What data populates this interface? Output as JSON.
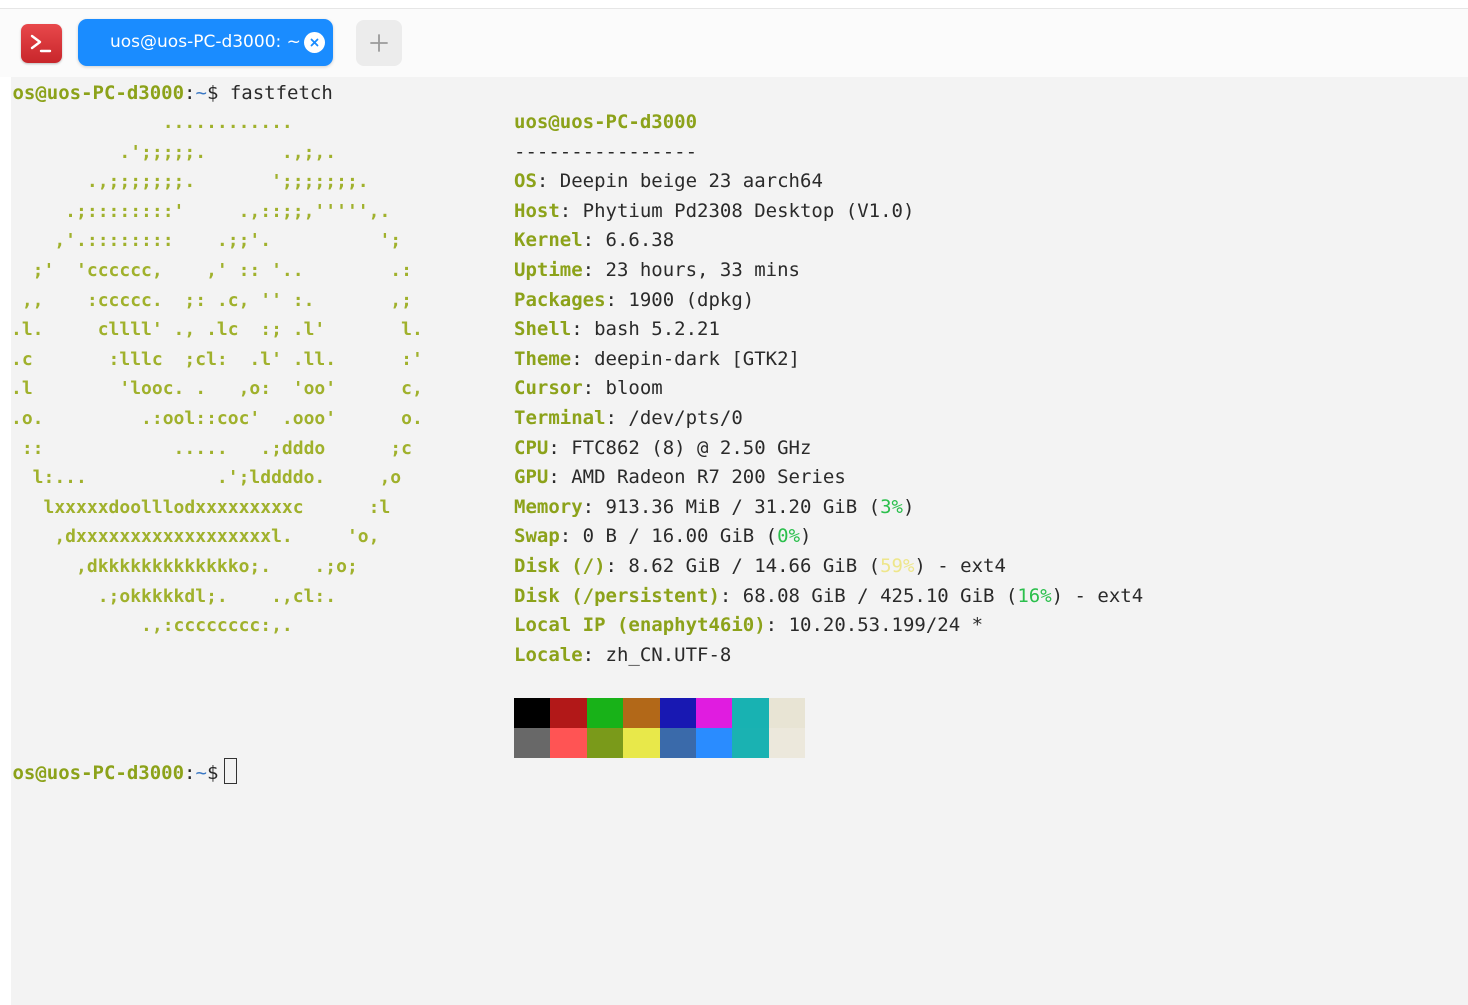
{
  "window": {
    "tab_title": "uos@uos-PC-d3000: ~",
    "icon_names": [
      "terminal-app-icon",
      "close-icon",
      "plus-icon"
    ]
  },
  "terminal": {
    "prompt1": {
      "user_host": "uos@uos-PC-d3000",
      "sep": ":",
      "path": "~",
      "dollar": "$",
      "command": " fastfetch"
    },
    "prompt2": {
      "user_host": "uos@uos-PC-d3000",
      "sep": ":",
      "path": "~",
      "dollar": "$"
    },
    "logo_color": "#a0b12c",
    "logo_lines": [
      "              ............",
      "          .';;;;;.       .,;,.",
      "       .,;;;;;;;.       ';;;;;;;.",
      "     .;::::::::'     .,::;;,''''',.",
      "    ,'.::::::::    .;;'.          ';",
      "  ;'  'cccccc,    ,' :: '..        .:",
      " ,,    :ccccc.  ;: .c, '' :.       ,;",
      ".l.     cllll' ., .lc  :; .l'       l.",
      ".c       :lllc  ;cl:  .l' .ll.      :'",
      ".l        'looc. .   ,o:  'oo'      c,",
      ".o.         .:ool::coc'  .ooo'      o.",
      " ::            .....   .;dddo      ;c",
      "  l:...            .';lddddo.     ,o",
      "   lxxxxxdoolllodxxxxxxxxxc      :l",
      "    ,dxxxxxxxxxxxxxxxxxxl.     'o,",
      "      ,dkkkkkkkkkkkkko;.    .;o;",
      "        .;okkkkkdl;.    .,cl:.",
      "            .,:cccccccc:,."
    ],
    "info": {
      "title": "uos@uos-PC-d3000",
      "separator": "----------------",
      "entries": [
        {
          "key": "OS",
          "value": "Deepin beige 23 aarch64"
        },
        {
          "key": "Host",
          "value": "Phytium Pd2308 Desktop (V1.0)"
        },
        {
          "key": "Kernel",
          "value": "6.6.38"
        },
        {
          "key": "Uptime",
          "value": "23 hours, 33 mins"
        },
        {
          "key": "Packages",
          "value": "1900 (dpkg)"
        },
        {
          "key": "Shell",
          "value": "bash 5.2.21"
        },
        {
          "key": "Theme",
          "value": "deepin-dark [GTK2]"
        },
        {
          "key": "Cursor",
          "value": "bloom"
        },
        {
          "key": "Terminal",
          "value": "/dev/pts/0"
        },
        {
          "key": "CPU",
          "value": "FTC862 (8) @ 2.50 GHz"
        },
        {
          "key": "GPU",
          "value": "AMD Radeon R7 200 Series"
        },
        {
          "key": "Memory",
          "pre": "913.36 MiB / 31.20 GiB (",
          "pct": "3%",
          "pct_color": "green",
          "post": ")"
        },
        {
          "key": "Swap",
          "pre": "0 B / 16.00 GiB (",
          "pct": "0%",
          "pct_color": "green",
          "post": ")"
        },
        {
          "key": "Disk (/)",
          "pre": "8.62 GiB / 14.66 GiB (",
          "pct": "59%",
          "pct_color": "yellow",
          "post": ") - ext4"
        },
        {
          "key": "Disk (/persistent)",
          "pre": "68.08 GiB / 425.10 GiB (",
          "pct": "16%",
          "pct_color": "green",
          "post": ") - ext4"
        },
        {
          "key": "Local IP (enaphyt46i0)",
          "value": "10.20.53.199/24 *"
        },
        {
          "key": "Locale",
          "value": "zh_CN.UTF-8"
        }
      ]
    },
    "palette": {
      "normal": [
        "#000000",
        "#b21818",
        "#18b218",
        "#b26818",
        "#1818b2",
        "#e01ce0",
        "#18b2b2",
        "#e8e4d4"
      ],
      "bright": [
        "#686868",
        "#ff5454",
        "#7a9a1a",
        "#e8e84a",
        "#3a6aaa",
        "#2a8cff",
        "#1ab2b2",
        "#ece8dc"
      ]
    }
  }
}
